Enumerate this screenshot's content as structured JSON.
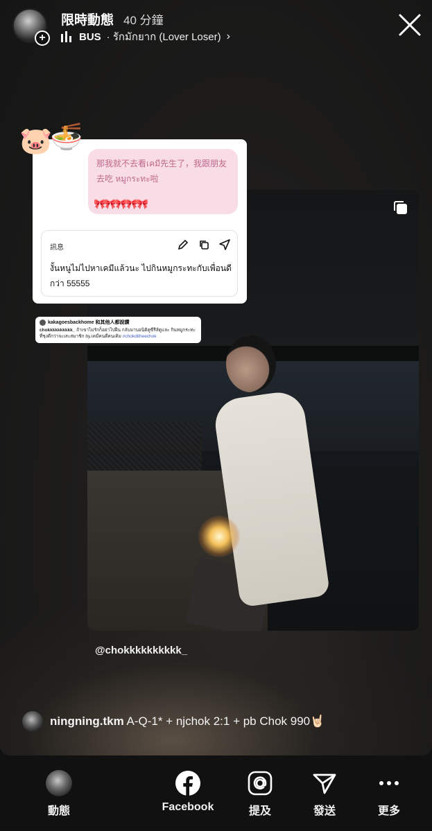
{
  "header": {
    "username": "限時動態",
    "timestamp": "40 分鐘",
    "music_title": "BUS",
    "music_subtitle": "· รักมักยาก (Lover Loser)",
    "chevron": "›"
  },
  "stickers": {
    "pig": "🐷",
    "noodles": "🍜"
  },
  "note_card": {
    "pink_text": "那我就不去看เคมี先生了，我跟朋友去吃 หมูกระทะ啦",
    "ribbons": "🎀🎀🎀🎀🎀",
    "message_label": "訊息",
    "message_text": "งั้นหนูไม่ไปหาเคมีแล้วนะ ไปกินหมูกระทะกับเพื่อนดีกว่า 55555"
  },
  "comment": {
    "header": "kakagoesbackhome 和其他人都說讚",
    "username": "chokkkkkkkkkk_",
    "body": "ถ้าเขาไม่รักก็อย่าไปฝืน กลับมาบอนิติคูซีรีส์ดูและ กินหมูกระทะที่ชุงดีกว่าจะเสะสมาชิก by.เคมีคนดีคนเดิม",
    "tag": "#chokditheechok"
  },
  "mention": "@chokkkkkkkkkk_",
  "caption": {
    "username": "ningning.tkm",
    "text": "A-Q-1* + njchok 2:1 + pb Chok 990🤘🏻"
  },
  "bottom_nav": {
    "items": [
      {
        "label": "動態",
        "icon": "avatar"
      },
      {
        "label": "Facebook",
        "icon": "facebook-icon"
      },
      {
        "label": "提及",
        "icon": "mention-icon"
      },
      {
        "label": "發送",
        "icon": "send-icon"
      },
      {
        "label": "更多",
        "icon": "more-icon"
      }
    ]
  }
}
